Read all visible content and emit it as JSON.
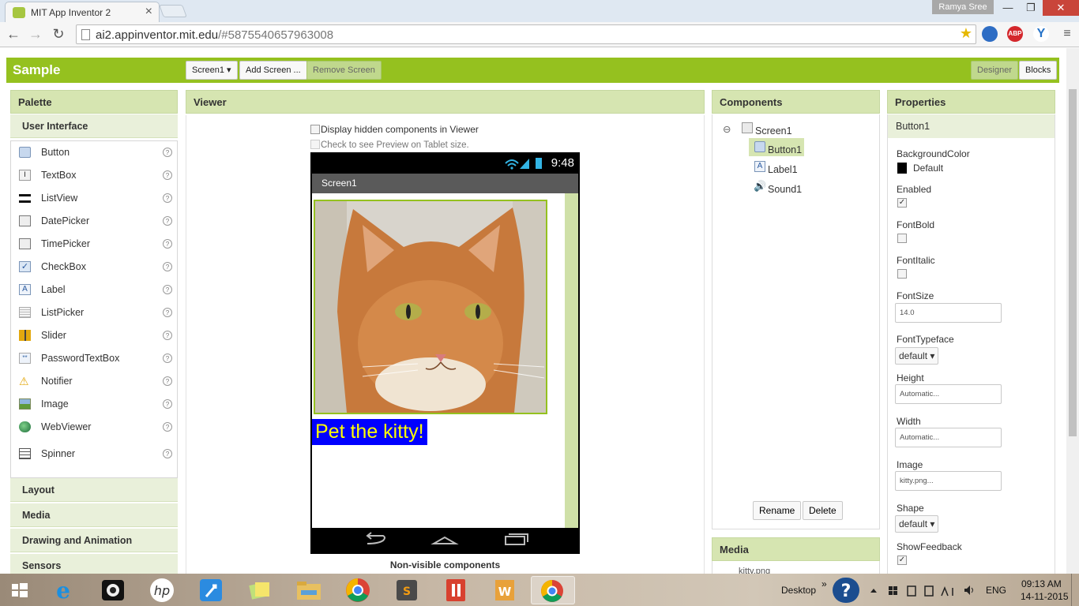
{
  "browser": {
    "tab_title": "MIT App Inventor 2",
    "tab_close": "×",
    "profile_name": "Ramya Sree",
    "url_host": "ai2.appinventor.mit.edu",
    "url_rest": "/#5875540657963008"
  },
  "header": {
    "project_name": "Sample",
    "screen_select": "Screen1 ▾",
    "add_screen": "Add Screen ...",
    "remove_screen": "Remove Screen",
    "designer": "Designer",
    "blocks": "Blocks",
    "colors": {
      "bar": "#95c11f"
    }
  },
  "palette": {
    "title": "Palette",
    "category_open": "User Interface",
    "items": [
      {
        "label": "Button",
        "icon": "button-icon"
      },
      {
        "label": "TextBox",
        "icon": "textbox-icon"
      },
      {
        "label": "ListView",
        "icon": "listview-icon"
      },
      {
        "label": "DatePicker",
        "icon": "datepicker-icon"
      },
      {
        "label": "TimePicker",
        "icon": "timepicker-icon"
      },
      {
        "label": "CheckBox",
        "icon": "checkbox-icon"
      },
      {
        "label": "Label",
        "icon": "label-icon"
      },
      {
        "label": "ListPicker",
        "icon": "listpicker-icon"
      },
      {
        "label": "Slider",
        "icon": "slider-icon"
      },
      {
        "label": "PasswordTextBox",
        "icon": "password-icon"
      },
      {
        "label": "Notifier",
        "icon": "notifier-icon"
      },
      {
        "label": "Image",
        "icon": "image-icon"
      },
      {
        "label": "WebViewer",
        "icon": "webviewer-icon"
      },
      {
        "label": "Spinner",
        "icon": "spinner-icon"
      }
    ],
    "help_glyph": "?",
    "categories": [
      "Layout",
      "Media",
      "Drawing and Animation",
      "Sensors"
    ]
  },
  "viewer": {
    "title": "Viewer",
    "hidden_components": "Display hidden components in Viewer",
    "tablet_preview": "Check to see Preview on Tablet size.",
    "status_time": "9:48",
    "screen_title": "Screen1",
    "label_text": "Pet the kitty!",
    "nonvisible": "Non-visible components"
  },
  "components": {
    "title": "Components",
    "tree": [
      {
        "label": "Screen1",
        "icon": "screen-icon",
        "level": 0
      },
      {
        "label": "Button1",
        "icon": "button-icon",
        "level": 1,
        "selected": true
      },
      {
        "label": "Label1",
        "icon": "label-icon",
        "level": 1
      },
      {
        "label": "Sound1",
        "icon": "sound-icon",
        "level": 1
      }
    ],
    "collapse_glyph": "⊖",
    "rename": "Rename",
    "delete": "Delete",
    "media_title": "Media",
    "media_file": "kitty.png"
  },
  "properties": {
    "title": "Properties",
    "component": "Button1",
    "background_color": {
      "label": "BackgroundColor",
      "value": "Default",
      "swatch": "#000000"
    },
    "enabled": {
      "label": "Enabled",
      "checked": true
    },
    "font_bold": {
      "label": "FontBold",
      "checked": false
    },
    "font_italic": {
      "label": "FontItalic",
      "checked": false
    },
    "font_size": {
      "label": "FontSize",
      "value": "14.0"
    },
    "font_typeface": {
      "label": "FontTypeface",
      "value": "default ▾"
    },
    "height": {
      "label": "Height",
      "value": "Automatic..."
    },
    "width": {
      "label": "Width",
      "value": "Automatic..."
    },
    "image": {
      "label": "Image",
      "value": "kitty.png..."
    },
    "shape": {
      "label": "Shape",
      "value": "default ▾"
    },
    "show_feedback": {
      "label": "ShowFeedback",
      "checked": true
    },
    "check_glyph": "✓"
  },
  "taskbar": {
    "desktop": "Desktop",
    "chevron": "»",
    "language": "ENG",
    "time": "09:13 AM",
    "date": "14-11-2015"
  }
}
